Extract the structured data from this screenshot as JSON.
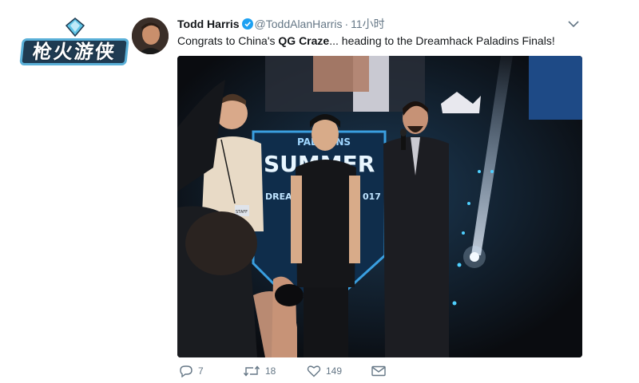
{
  "logo": {
    "text": "枪火游侠"
  },
  "tweet": {
    "author_name": "Todd Harris",
    "handle": "@ToddAlanHarris",
    "separator": "·",
    "time": "11小时",
    "text_before": "Congrats to China's ",
    "text_bold": "QG Craze",
    "text_after": "... heading to the Dreamhack Paladins Finals!"
  },
  "photo": {
    "banner_line1": "PALADINS",
    "banner_line2": "SUMMER",
    "banner_line3_left": "DREA",
    "banner_line3_right": "017",
    "badge": "STAFF"
  },
  "actions": {
    "reply_count": "7",
    "retweet_count": "18",
    "like_count": "149"
  },
  "colors": {
    "verified": "#1da1f2",
    "meta_gray": "#657786",
    "text": "#14171a"
  }
}
